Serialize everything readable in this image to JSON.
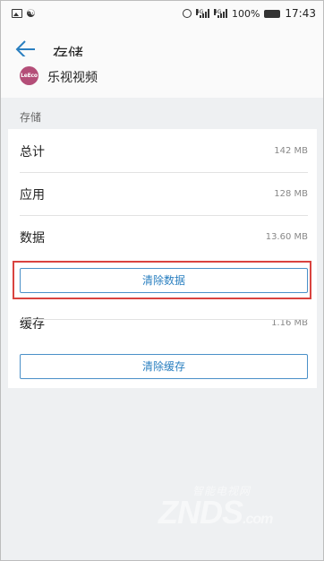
{
  "status_bar": {
    "battery": "100%",
    "time": "17:43"
  },
  "header": {
    "title": "存储"
  },
  "app": {
    "name": "乐视视频",
    "logo_text": "LeEco"
  },
  "section": {
    "label": "存储"
  },
  "storage": {
    "total": {
      "label": "总计",
      "value": "142 MB"
    },
    "app": {
      "label": "应用",
      "value": "128 MB"
    },
    "data": {
      "label": "数据",
      "value": "13.60 MB"
    },
    "clear_data_button": "清除数据",
    "cache": {
      "label": "缓存",
      "value": "1.16 MB"
    },
    "clear_cache_button": "清除缓存"
  },
  "watermark": {
    "cn": "智能电视网",
    "en": "ZNDS",
    "suffix": ".com"
  },
  "colors": {
    "accent": "#2a7fc0",
    "highlight": "#d9433f",
    "logo": "#b44e78"
  }
}
